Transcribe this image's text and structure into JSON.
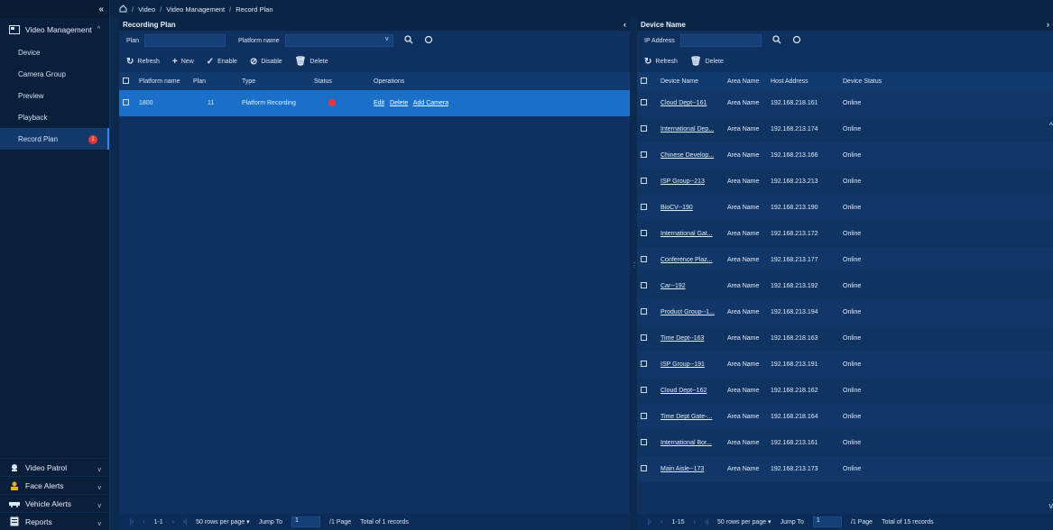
{
  "sidebar": {
    "collapse_label": "«",
    "group_main": "Video Management",
    "items": [
      {
        "label": "Device"
      },
      {
        "label": "Camera Group"
      },
      {
        "label": "Preview"
      },
      {
        "label": "Playback"
      },
      {
        "label": "Record Plan",
        "badge": "1"
      }
    ],
    "bottom_groups": [
      {
        "label": "Video Patrol"
      },
      {
        "label": "Face Alerts"
      },
      {
        "label": "Vehicle Alerts"
      },
      {
        "label": "Reports"
      }
    ]
  },
  "breadcrumb": {
    "home_icon": "home-icon",
    "items": [
      "Video",
      "Video Management",
      "Record Plan"
    ]
  },
  "left_panel": {
    "title": "Recording Plan",
    "filter": {
      "plan_label": "Plan",
      "platform_label": "Platform name"
    },
    "toolbar": {
      "refresh": "Refresh",
      "new": "New",
      "enable": "Enable",
      "disable": "Disable",
      "delete": "Delete"
    },
    "columns": [
      "Platform name",
      "Plan",
      "Type",
      "Status",
      "Operations"
    ],
    "rows": [
      {
        "platform": "1800",
        "plan": "11",
        "type": "Platform Recording",
        "ops": [
          "Edit",
          "Delete",
          "Add Camera"
        ]
      }
    ],
    "pager": {
      "range": "1-1",
      "per_page": "50 rows per page",
      "jump_label": "Jump To",
      "jump_value": "1",
      "pages": "/1 Page",
      "total": "Total of 1 records"
    }
  },
  "right_panel": {
    "title": "Device Name",
    "filter": {
      "ip_label": "IP Address"
    },
    "toolbar": {
      "refresh": "Refresh",
      "delete": "Delete"
    },
    "columns": [
      "Device Name",
      "Area Name",
      "Host Address",
      "Device Status"
    ],
    "rows": [
      {
        "name": "Cloud Dept--161",
        "area": "Area Name",
        "host": "192.168.218.161",
        "status": "Online"
      },
      {
        "name": "International Dep...",
        "area": "Area Name",
        "host": "192.168.213.174",
        "status": "Online"
      },
      {
        "name": "Chinese Develop...",
        "area": "Area Name",
        "host": "192.168.213.166",
        "status": "Online"
      },
      {
        "name": "ISP Group--213",
        "area": "Area Name",
        "host": "192.168.213.213",
        "status": "Online"
      },
      {
        "name": "BioCV--190",
        "area": "Area Name",
        "host": "192.168.213.190",
        "status": "Online"
      },
      {
        "name": "International Gat...",
        "area": "Area Name",
        "host": "192.168.213.172",
        "status": "Online"
      },
      {
        "name": "Conference Plaz...",
        "area": "Area Name",
        "host": "192.168.213.177",
        "status": "Online"
      },
      {
        "name": "Car--192",
        "area": "Area Name",
        "host": "192.168.213.192",
        "status": "Online"
      },
      {
        "name": "Product Group--1...",
        "area": "Area Name",
        "host": "192.168.213.194",
        "status": "Online"
      },
      {
        "name": "Time Dept--163",
        "area": "Area Name",
        "host": "192.168.218.163",
        "status": "Online"
      },
      {
        "name": "ISP Group--191",
        "area": "Area Name",
        "host": "192.168.213.191",
        "status": "Online"
      },
      {
        "name": "Cloud Dept--162",
        "area": "Area Name",
        "host": "192.168.218.162",
        "status": "Online"
      },
      {
        "name": "Time Dept Gate-...",
        "area": "Area Name",
        "host": "192.168.218.164",
        "status": "Online"
      },
      {
        "name": "International Bor...",
        "area": "Area Name",
        "host": "192.168.213.161",
        "status": "Online"
      },
      {
        "name": "Main Aisle--173",
        "area": "Area Name",
        "host": "192.168.213.173",
        "status": "Online"
      }
    ],
    "pager": {
      "range": "1-15",
      "per_page": "50 rows per page",
      "jump_label": "Jump To",
      "jump_value": "1",
      "pages": "/1 Page",
      "total": "Total of 15 records"
    }
  },
  "colors": {
    "background": "#0c2a4e",
    "sidebar": "#0a1f3c",
    "selected_row": "#1a70c8",
    "status_red": "#e53935"
  }
}
